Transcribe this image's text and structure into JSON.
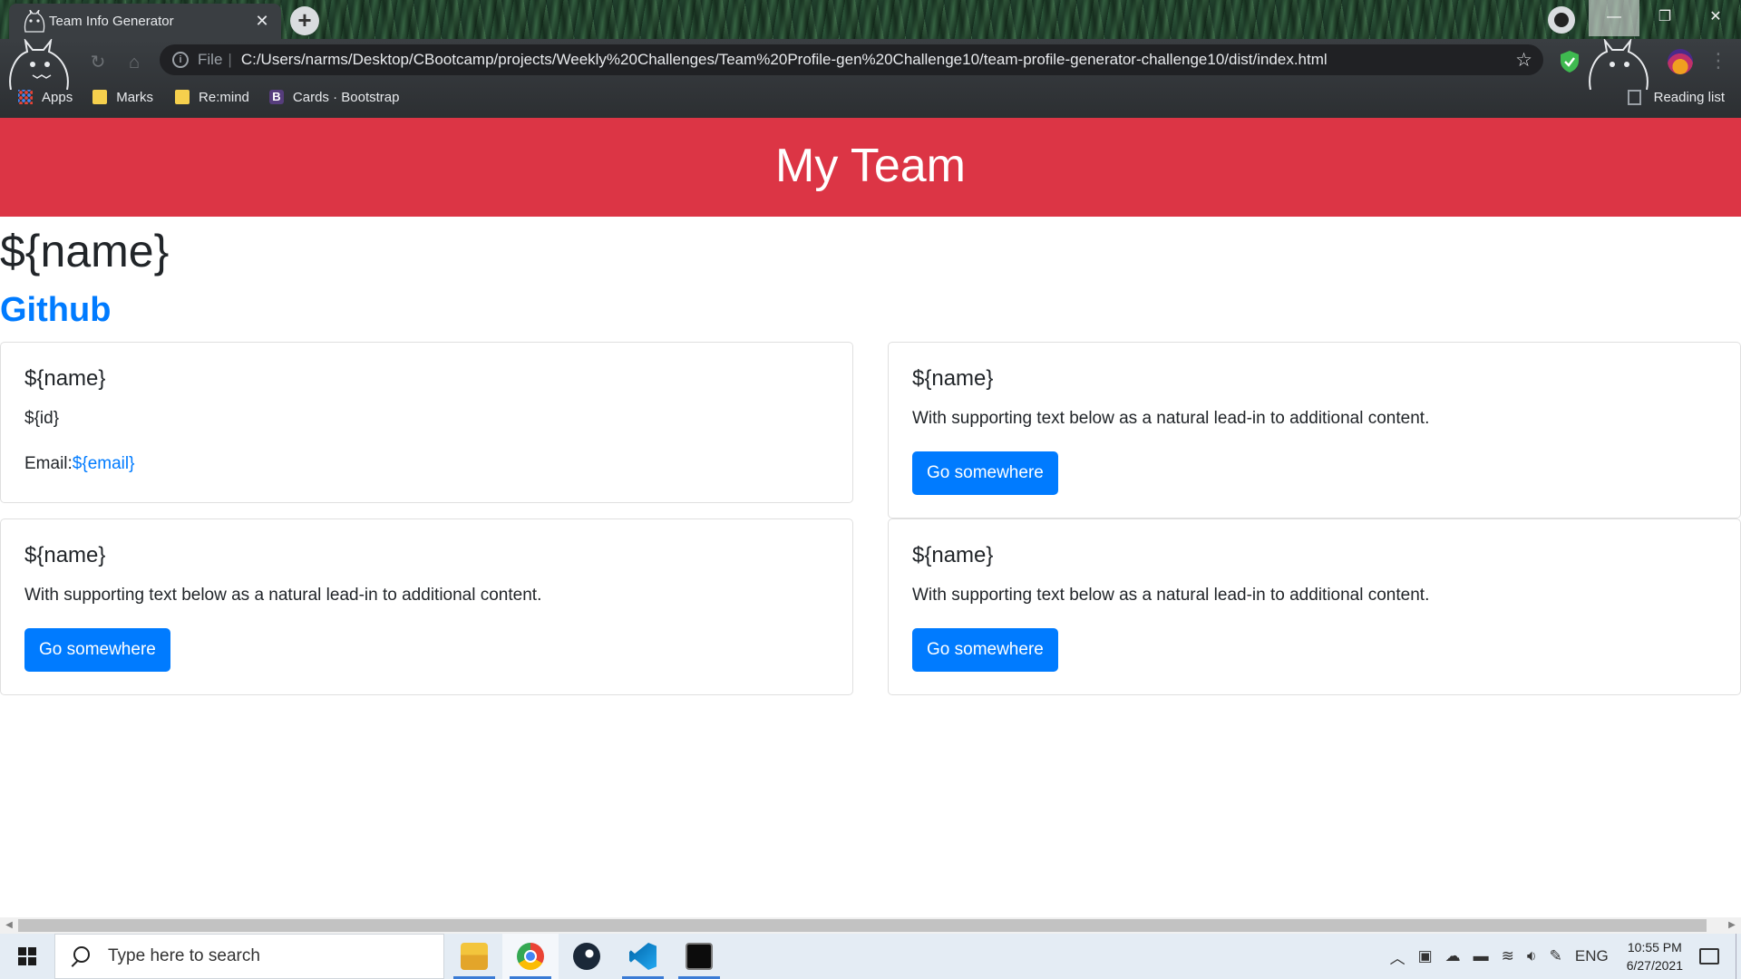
{
  "browser": {
    "tab_title": "Team Info Generator",
    "tab_close": "✕",
    "new_tab": "+",
    "url_scheme": "File",
    "url": "C:/Users/narms/Desktop/CBootcamp/projects/Weekly%20Challenges/Team%20Profile-gen%20Challenge10/team-profile-generator-challenge10/dist/index.html",
    "bookmarks": [
      {
        "label": "Apps"
      },
      {
        "label": "Marks"
      },
      {
        "label": "Re:mind"
      },
      {
        "label": "Cards · Bootstrap"
      }
    ],
    "reading_list": "Reading list",
    "window_buttons": {
      "minimize": "—",
      "restore": "❐",
      "close": "✕"
    }
  },
  "page": {
    "header_title": "My Team",
    "main_name": "${name}",
    "github_link": "Github",
    "cards": [
      {
        "title": "${name}",
        "id": "${id}",
        "email_label": "Email:",
        "email_value": "${email}"
      },
      {
        "title": "${name}",
        "text": "With supporting text below as a natural lead-in to additional content.",
        "button": "Go somewhere"
      },
      {
        "title": "${name}",
        "text": "With supporting text below as a natural lead-in to additional content.",
        "button": "Go somewhere"
      },
      {
        "title": "${name}",
        "text": "With supporting text below as a natural lead-in to additional content.",
        "button": "Go somewhere"
      }
    ]
  },
  "taskbar": {
    "search_placeholder": "Type here to search",
    "language": "ENG",
    "time": "10:55 PM",
    "date": "6/27/2021"
  },
  "colors": {
    "header_red": "#dc3545",
    "link_blue": "#007bff",
    "button_blue": "#007bff"
  },
  "icons": {
    "favicon": "totoro-icon",
    "info": "info-icon",
    "star": "bookmark-star-icon",
    "shield": "shield-icon",
    "profile": "profile-avatar",
    "search": "search-icon",
    "apps": [
      "file-explorer-icon",
      "chrome-icon",
      "steam-icon",
      "vscode-icon",
      "terminal-icon"
    ]
  }
}
